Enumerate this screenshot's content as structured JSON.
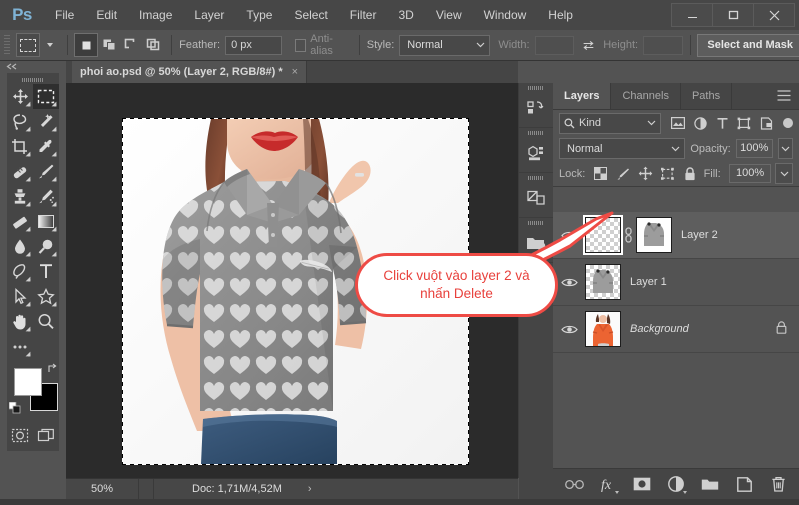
{
  "app": {
    "name": "Adobe Photoshop",
    "logo_text": "Ps",
    "accent_color": "#7fb3d5",
    "panel_bg": "#535353",
    "canvas_bg": "#2b2b2b",
    "callout_color": "#ee4b45"
  },
  "menubar": {
    "items": [
      "File",
      "Edit",
      "Image",
      "Layer",
      "Type",
      "Select",
      "Filter",
      "3D",
      "View",
      "Window",
      "Help"
    ],
    "window_controls": [
      "minimize",
      "maximize",
      "close"
    ]
  },
  "options_bar": {
    "tool": "rectangular-marquee",
    "selection_modes": [
      "new-selection",
      "add-to-selection",
      "subtract-from-selection",
      "intersect-with-selection"
    ],
    "active_selection_mode": 0,
    "feather_label": "Feather:",
    "feather_value": "0 px",
    "antialias_label": "Anti-alias",
    "antialias_checked": false,
    "style_label": "Style:",
    "style_value": "Normal",
    "width_label": "Width:",
    "width_value": "",
    "height_label": "Height:",
    "height_value": "",
    "swap_icon": "swap-arrows-icon",
    "select_and_mask_label": "Select and Mask"
  },
  "toolbar": {
    "tools": [
      {
        "name": "move-tool",
        "icon": "move"
      },
      {
        "name": "rectangular-marquee-tool",
        "icon": "marquee",
        "active": true
      },
      {
        "name": "lasso-tool",
        "icon": "lasso"
      },
      {
        "name": "magic-wand-tool",
        "icon": "wand"
      },
      {
        "name": "crop-tool",
        "icon": "crop"
      },
      {
        "name": "eyedropper-tool",
        "icon": "eyedropper"
      },
      {
        "name": "spot-healing-brush-tool",
        "icon": "healing"
      },
      {
        "name": "brush-tool",
        "icon": "brush"
      },
      {
        "name": "clone-stamp-tool",
        "icon": "stamp"
      },
      {
        "name": "history-brush-tool",
        "icon": "history-brush"
      },
      {
        "name": "eraser-tool",
        "icon": "eraser"
      },
      {
        "name": "gradient-tool",
        "icon": "gradient"
      },
      {
        "name": "blur-tool",
        "icon": "blur-drop"
      },
      {
        "name": "dodge-tool",
        "icon": "dodge"
      },
      {
        "name": "pen-tool",
        "icon": "pen"
      },
      {
        "name": "type-tool",
        "icon": "type-T"
      },
      {
        "name": "path-selection-tool",
        "icon": "arrow-cursor"
      },
      {
        "name": "shape-tool",
        "icon": "star-shape"
      },
      {
        "name": "hand-tool",
        "icon": "hand"
      },
      {
        "name": "zoom-tool",
        "icon": "magnifier"
      },
      {
        "name": "edit-toolbar",
        "icon": "ellipsis"
      }
    ],
    "foreground_color": "#ffffff",
    "background_color": "#000000",
    "quick_mask_icon": "quick-mask-icon",
    "screen_mode_icon": "screen-mode-icon"
  },
  "document": {
    "tab_title": "phoi ao.psd @ 50% (Layer 2, RGB/8#) *",
    "close_glyph": "×",
    "zoom_level": "50%",
    "doc_info": "Doc: 1,71M/4,52M",
    "status_arrow": "›"
  },
  "panel_rail": {
    "items": [
      {
        "name": "history-panel-icon"
      },
      {
        "name": "properties-panel-icon"
      },
      {
        "name": "adjustments-panel-icon"
      },
      {
        "name": "libraries-panel-icon"
      }
    ]
  },
  "layers_panel": {
    "tabs": [
      {
        "label": "Layers",
        "active": true
      },
      {
        "label": "Channels",
        "active": false
      },
      {
        "label": "Paths",
        "active": false
      }
    ],
    "menu_icon": "hamburger-menu-icon",
    "filter": {
      "kind_label": "Kind",
      "search_icon": "search-icon",
      "filter_icons": [
        "pixel-filter-icon",
        "adjustment-filter-icon",
        "type-filter-icon",
        "shape-filter-icon",
        "smart-object-filter-icon"
      ],
      "toggle_icon": "filter-toggle-icon"
    },
    "blend_mode": "Normal",
    "opacity_label": "Opacity:",
    "opacity_value": "100%",
    "lock_label": "Lock:",
    "lock_icons": [
      "lock-transparent-pixels-icon",
      "lock-image-pixels-icon",
      "lock-position-icon",
      "lock-artboard-icon",
      "lock-all-icon"
    ],
    "fill_label": "Fill:",
    "fill_value": "100%",
    "layers": [
      {
        "name": "Layer 2",
        "visible": true,
        "selected": true,
        "thumb_type": "transparent",
        "has_mask": true,
        "linked": true,
        "locked": false,
        "italic": false
      },
      {
        "name": "Layer 1",
        "visible": true,
        "selected": false,
        "thumb_type": "shirt",
        "has_mask": false,
        "linked": false,
        "locked": false,
        "italic": false
      },
      {
        "name": "Background",
        "visible": true,
        "selected": false,
        "thumb_type": "photo",
        "has_mask": false,
        "linked": false,
        "locked": true,
        "italic": true
      }
    ],
    "footer_buttons": [
      {
        "name": "link-layers-button",
        "icon": "link-icon"
      },
      {
        "name": "layer-style-button",
        "icon": "fx-icon"
      },
      {
        "name": "add-layer-mask-button",
        "icon": "mask-icon"
      },
      {
        "name": "new-adjustment-layer-button",
        "icon": "half-circle-icon"
      },
      {
        "name": "new-group-button",
        "icon": "folder-icon"
      },
      {
        "name": "new-layer-button",
        "icon": "new-layer-icon"
      },
      {
        "name": "delete-layer-button",
        "icon": "trash-icon"
      }
    ]
  },
  "callout": {
    "line1": "Click vuột vào layer 2 và",
    "line2": "nhấn Delete",
    "text": "Click vuột vào layer 2 và nhấn Delete"
  }
}
